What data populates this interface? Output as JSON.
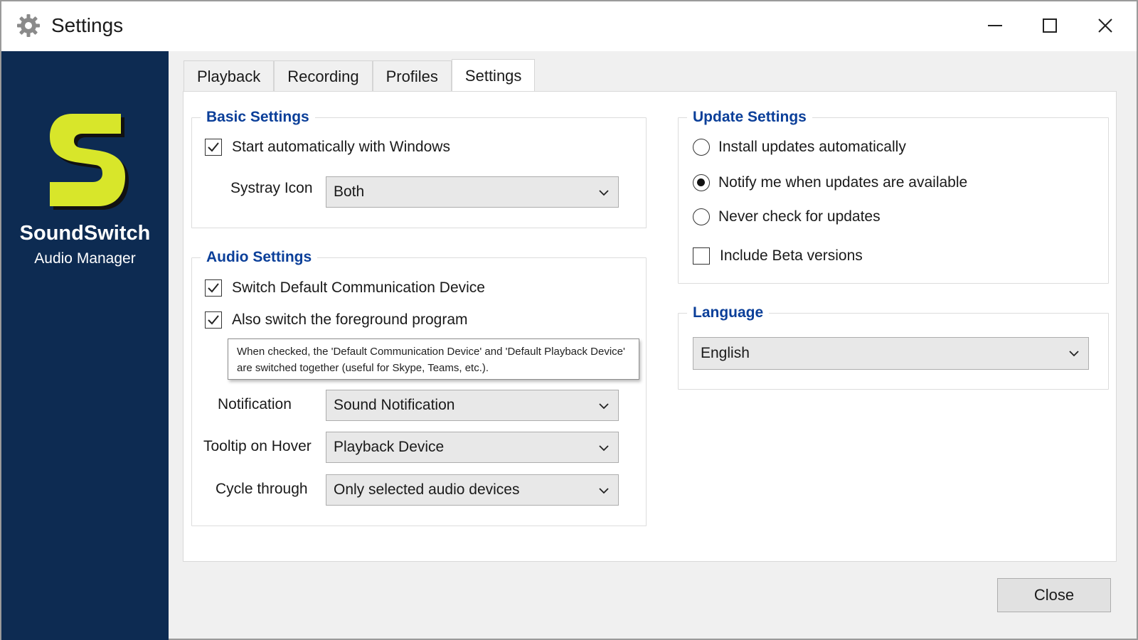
{
  "window": {
    "title": "Settings",
    "icon": "gear-icon"
  },
  "brand": {
    "name": "SoundSwitch",
    "subtitle": "Audio Manager",
    "logo_color": "#d8e62a",
    "sidebar_color": "#0d2b52"
  },
  "tabs": [
    {
      "label": "Playback",
      "active": false
    },
    {
      "label": "Recording",
      "active": false
    },
    {
      "label": "Profiles",
      "active": false
    },
    {
      "label": "Settings",
      "active": true
    }
  ],
  "basic_settings": {
    "legend": "Basic Settings",
    "start_with_windows": {
      "label": "Start automatically with Windows",
      "checked": true
    },
    "systray_icon": {
      "label": "Systray Icon",
      "value": "Both"
    }
  },
  "audio_settings": {
    "legend": "Audio Settings",
    "switch_comm_device": {
      "label": "Switch Default Communication Device",
      "checked": true
    },
    "switch_foreground": {
      "label": "Also switch the foreground program",
      "checked": true
    },
    "tooltip": {
      "line1": "When checked, the 'Default Communication Device' and 'Default Playback Device'",
      "line2": "are switched together (useful for Skype, Teams, etc.)."
    },
    "notification": {
      "label": "Notification",
      "value": "Sound Notification"
    },
    "tooltip_on_hover": {
      "label": "Tooltip on Hover",
      "value": "Playback Device"
    },
    "cycle_through": {
      "label": "Cycle through",
      "value": "Only selected audio devices"
    }
  },
  "update_settings": {
    "legend": "Update Settings",
    "options": [
      {
        "label": "Install updates automatically",
        "selected": false
      },
      {
        "label": "Notify me when updates are available",
        "selected": true
      },
      {
        "label": "Never check for updates",
        "selected": false
      }
    ],
    "include_beta": {
      "label": "Include Beta versions",
      "checked": false
    }
  },
  "language": {
    "legend": "Language",
    "value": "English"
  },
  "footer": {
    "close_label": "Close"
  },
  "colors": {
    "accent": "#0b3f99"
  }
}
